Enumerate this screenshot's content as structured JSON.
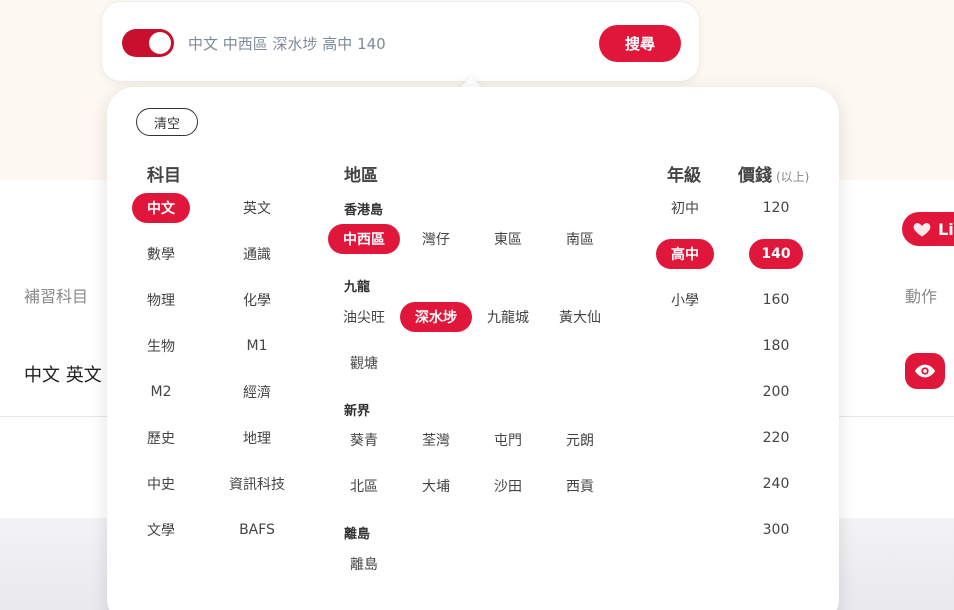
{
  "search": {
    "query": "中文 中西區 深水埗 高中 140",
    "button_label": "搜尋",
    "toggle_on": true
  },
  "background": {
    "column_header": "補習科目",
    "action_header": "動作",
    "row_subjects": "中文 英文",
    "like_label": "Li"
  },
  "panel": {
    "clear_label": "清空",
    "subjects": {
      "title": "科目",
      "items": [
        {
          "label": "中文",
          "selected": true
        },
        {
          "label": "英文",
          "selected": false
        },
        {
          "label": "數學",
          "selected": false
        },
        {
          "label": "通識",
          "selected": false
        },
        {
          "label": "物理",
          "selected": false
        },
        {
          "label": "化學",
          "selected": false
        },
        {
          "label": "生物",
          "selected": false
        },
        {
          "label": "M1",
          "selected": false
        },
        {
          "label": "M2",
          "selected": false
        },
        {
          "label": "經濟",
          "selected": false
        },
        {
          "label": "歷史",
          "selected": false
        },
        {
          "label": "地理",
          "selected": false
        },
        {
          "label": "中史",
          "selected": false
        },
        {
          "label": "資訊科技",
          "selected": false
        },
        {
          "label": "文學",
          "selected": false
        },
        {
          "label": "BAFS",
          "selected": false
        }
      ]
    },
    "districts": {
      "title": "地區",
      "groups": [
        {
          "name": "香港島",
          "items": [
            {
              "label": "中西區",
              "selected": true
            },
            {
              "label": "灣仔",
              "selected": false
            },
            {
              "label": "東區",
              "selected": false
            },
            {
              "label": "南區",
              "selected": false
            }
          ]
        },
        {
          "name": "九龍",
          "items": [
            {
              "label": "油尖旺",
              "selected": false
            },
            {
              "label": "深水埗",
              "selected": true
            },
            {
              "label": "九龍城",
              "selected": false
            },
            {
              "label": "黃大仙",
              "selected": false
            },
            {
              "label": "觀塘",
              "selected": false
            }
          ]
        },
        {
          "name": "新界",
          "items": [
            {
              "label": "葵青",
              "selected": false
            },
            {
              "label": "荃灣",
              "selected": false
            },
            {
              "label": "屯門",
              "selected": false
            },
            {
              "label": "元朗",
              "selected": false
            },
            {
              "label": "北區",
              "selected": false
            },
            {
              "label": "大埔",
              "selected": false
            },
            {
              "label": "沙田",
              "selected": false
            },
            {
              "label": "西貢",
              "selected": false
            }
          ]
        },
        {
          "name": "離島",
          "items": [
            {
              "label": "離島",
              "selected": false
            }
          ]
        }
      ]
    },
    "levels": {
      "title": "年級",
      "items": [
        {
          "label": "初中",
          "selected": false
        },
        {
          "label": "高中",
          "selected": true
        },
        {
          "label": "小學",
          "selected": false
        }
      ]
    },
    "prices": {
      "title": "價錢",
      "subtitle": "(以上)",
      "items": [
        {
          "label": "120",
          "selected": false
        },
        {
          "label": "140",
          "selected": true
        },
        {
          "label": "160",
          "selected": false
        },
        {
          "label": "180",
          "selected": false
        },
        {
          "label": "200",
          "selected": false
        },
        {
          "label": "220",
          "selected": false
        },
        {
          "label": "240",
          "selected": false
        },
        {
          "label": "300",
          "selected": false
        }
      ]
    }
  },
  "colors": {
    "accent": "#e0173a",
    "toggle": "#c8102e",
    "page_bg": "#fdf8f1"
  }
}
